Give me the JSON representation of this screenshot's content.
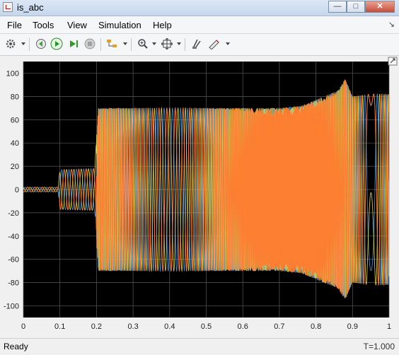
{
  "window": {
    "title": "is_abc",
    "minimize_glyph": "—",
    "maximize_glyph": "□",
    "close_glyph": "✕"
  },
  "menu": {
    "file": "File",
    "tools": "Tools",
    "view": "View",
    "simulation": "Simulation",
    "help": "Help"
  },
  "toolbar": {
    "icons": [
      "gear-icon",
      "step-back-icon",
      "run-icon",
      "step-forward-icon",
      "stop-icon",
      "signal-select-icon",
      "zoom-icon",
      "fit-icon",
      "style-icon",
      "highlight-icon"
    ]
  },
  "status": {
    "text": "Ready",
    "time_label": "T=1.000"
  },
  "chart_data": {
    "type": "line",
    "title": "",
    "xlabel": "",
    "ylabel": "",
    "xlim": [
      0,
      1
    ],
    "ylim": [
      -110,
      110
    ],
    "x_ticks": [
      "0",
      "0.1",
      "0.2",
      "0.3",
      "0.4",
      "0.5",
      "0.6",
      "0.7",
      "0.8",
      "0.9",
      "1"
    ],
    "y_ticks": [
      "100",
      "80",
      "60",
      "40",
      "20",
      "0",
      "-20",
      "-40",
      "-60",
      "-80",
      "-100"
    ],
    "grid": true,
    "colors": [
      "#4aa3f0",
      "#f5e84c",
      "#ff7a2e"
    ],
    "envelope": [
      {
        "x": 0.0,
        "amp": 2
      },
      {
        "x": 0.095,
        "amp": 2
      },
      {
        "x": 0.1,
        "amp": 17
      },
      {
        "x": 0.195,
        "amp": 18
      },
      {
        "x": 0.205,
        "amp": 70
      },
      {
        "x": 0.4,
        "amp": 70
      },
      {
        "x": 0.7,
        "amp": 70
      },
      {
        "x": 0.76,
        "amp": 72
      },
      {
        "x": 0.86,
        "amp": 85
      },
      {
        "x": 0.88,
        "amp": 95
      },
      {
        "x": 0.9,
        "amp": 80
      },
      {
        "x": 0.95,
        "amp": 82
      },
      {
        "x": 1.0,
        "amp": 82
      }
    ]
  }
}
